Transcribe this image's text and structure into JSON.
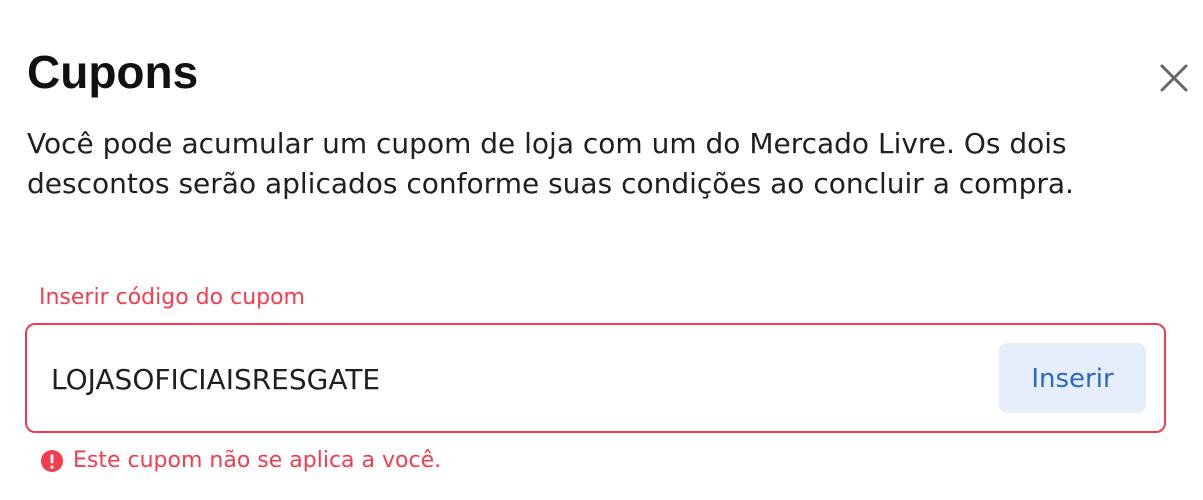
{
  "modal": {
    "title": "Cupons",
    "description": "Você pode acumular um cupom de loja com um do Mercado Livre. Os dois descontos serão aplicados conforme suas condições ao concluir a compra.",
    "close_icon": "close-icon"
  },
  "coupon_form": {
    "label": "Inserir código do cupom",
    "value": "LOJASOFICIAISRESGATE",
    "button_label": "Inserir",
    "error_message": "Este cupom não se aplica a você.",
    "error_icon": "error-icon"
  },
  "colors": {
    "error": "#f23d4f",
    "button_text": "#2968c8",
    "button_background": "#e6eefc"
  }
}
